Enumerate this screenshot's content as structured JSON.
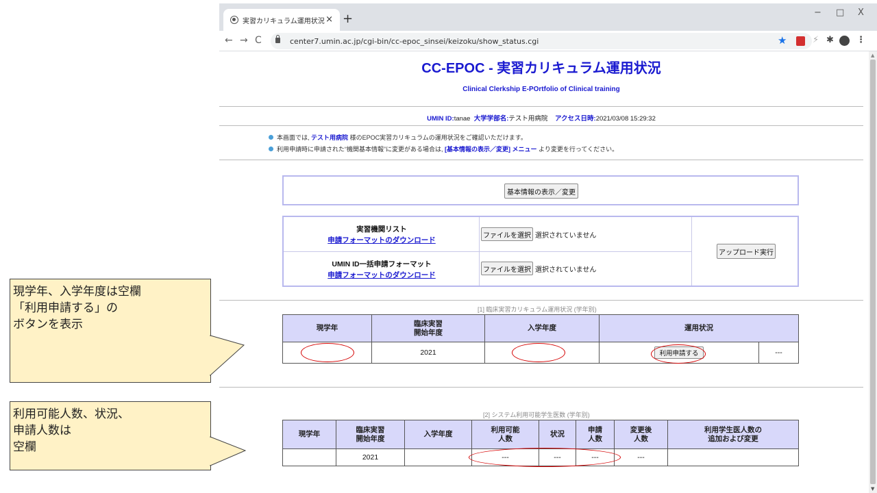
{
  "browser": {
    "tab_title": "実習カリキュラム運用状況",
    "tab_close": "×",
    "new_tab": "+",
    "win_min": "−",
    "win_max": "□",
    "win_close": "X",
    "nav_back": "←",
    "nav_forward": "→",
    "nav_reload": "C",
    "url": "center7.umin.ac.jp/cgi-bin/cc-epoc_sinsei/keizoku/show_status.cgi",
    "star": "★",
    "menu": "⋮",
    "puzzle": "✱",
    "ext2": "⚡"
  },
  "header": {
    "title": "CC-EPOC - 実習カリキュラム運用状況",
    "subtitle": "Clinical Clerkship E-POrtfolio of Clinical training",
    "umin_label": "UMIN ID:",
    "umin_value": "tanae",
    "univ_label": "大学学部名:",
    "univ_value": "テスト用病院",
    "access_label": "アクセス日時:",
    "access_value": "2021/03/08 15:29:32"
  },
  "notes": {
    "line1_a": "本画面では,",
    "line1_hl": "テスト用病院",
    "line1_b": "様のEPOC実習カリキュラムの運用状況をご確認いただけます。",
    "line2_a": "利用申請時に申請された“機関基本情報”に変更がある場合は,",
    "line2_hl": "[基本情報の表示／変更] メニュー",
    "line2_b": "より変更を行ってください。"
  },
  "basic_info_button": "基本情報の表示／変更",
  "upload": {
    "row1_label": "実習機関リスト",
    "row2_label": "UMIN ID一括申請フォーマット",
    "download_link": "申請フォーマットのダウンロード",
    "choose_file": "ファイルを選択",
    "no_file": "選択されていません",
    "upload_button": "アップロード実行"
  },
  "section1": {
    "caption": "[1] 臨床実習カリキュラム運用状況 (学年別)",
    "headers": [
      "現学年",
      "臨床実習\n開始年度",
      "入学年度",
      "運用状況"
    ],
    "row": {
      "grade": "",
      "start_year": "2021",
      "entry_year": "",
      "apply_button": "利用申請する",
      "status": "---"
    }
  },
  "section2": {
    "caption": "[2] システム利用可能学生医数 (学年別)",
    "headers": [
      "現学年",
      "臨床実習\n開始年度",
      "入学年度",
      "利用可能\n人数",
      "状況",
      "申請\n人数",
      "変更後\n人数",
      "利用学生医人数の\n追加および変更"
    ],
    "row": [
      "",
      "2021",
      "",
      "---",
      "---",
      "---",
      "---",
      ""
    ]
  },
  "callouts": {
    "c1_line1": "現学年、入学年度は空欄",
    "c1_line2": "「利用申請する」の",
    "c1_line3": "ボタンを表示",
    "c2_line1": "利用可能人数、状況、",
    "c2_line2": "申請人数は",
    "c2_line3": "空欄"
  },
  "colors": {
    "accent": "#1a1ad0",
    "table_header": "#d8d8fa",
    "callout_bg": "#fff2c6",
    "annotation_red": "#d40000"
  }
}
